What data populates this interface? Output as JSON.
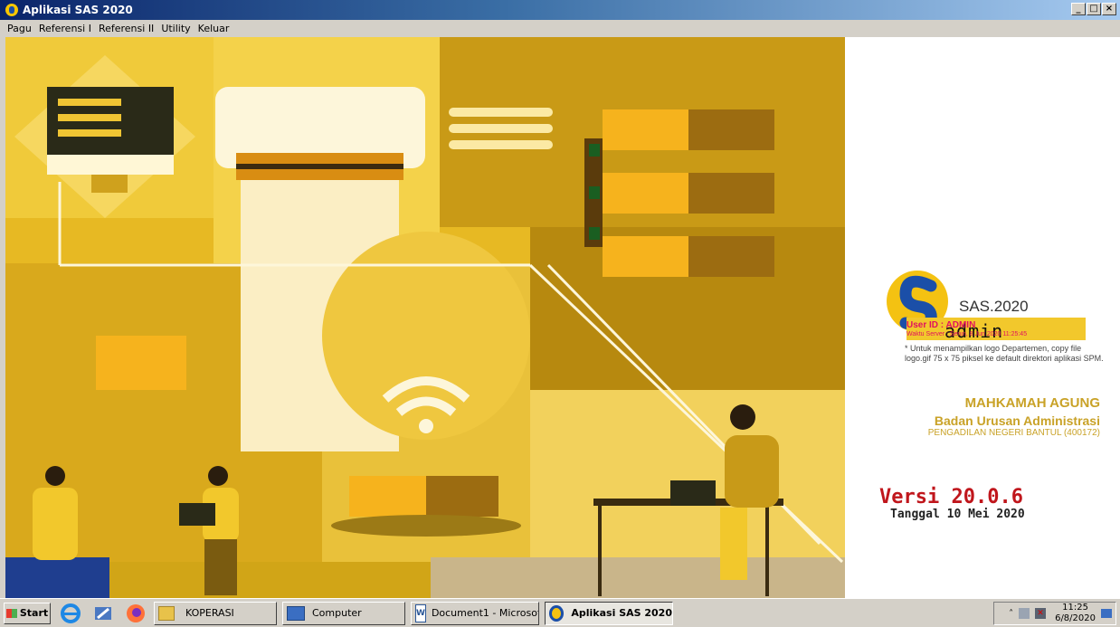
{
  "window": {
    "title": "Aplikasi SAS 2020",
    "controls": [
      "_",
      "□",
      "×"
    ]
  },
  "menu": {
    "items": [
      "Pagu",
      "Referensi I",
      "Referensi II",
      "Utility",
      "Keluar"
    ]
  },
  "panel": {
    "logo_text": "SAS.2020",
    "user_label": "User ID : ADMIN",
    "username": "admin",
    "server_time": "Waktu Server : Senin, 8 Jun 2020 11:25:45",
    "note": "* Untuk menampilkan logo Departemen, copy file logo.gif 75 x 75 piksel ke default direktori aplikasi SPM.",
    "org_name": "MAHKAMAH AGUNG",
    "org_unit": "Badan Urusan Administrasi",
    "org_office": "PENGADILAN NEGERI BANTUL (400172)",
    "version": "Versi 20.0.6",
    "release_date": "Tanggal 10 Mei 2020"
  },
  "taskbar": {
    "start_label": "Start",
    "quick_launch": [
      "internet-explorer-icon",
      "tool-icon",
      "firefox-icon"
    ],
    "buttons": [
      {
        "label": "KOPERASI",
        "icon": "folder-icon"
      },
      {
        "label": "Computer",
        "icon": "computer-icon"
      },
      {
        "label": "Document1 - Microsof...",
        "icon": "word-icon"
      },
      {
        "label": "Aplikasi SAS 2020",
        "icon": "sas-icon",
        "active": true
      }
    ],
    "clock_time": "11:25",
    "clock_date": "6/8/2020"
  },
  "colors": {
    "accent": "#f2c82c",
    "version": "#c0161c",
    "org": "#c9a227",
    "user": "#e0115f"
  }
}
